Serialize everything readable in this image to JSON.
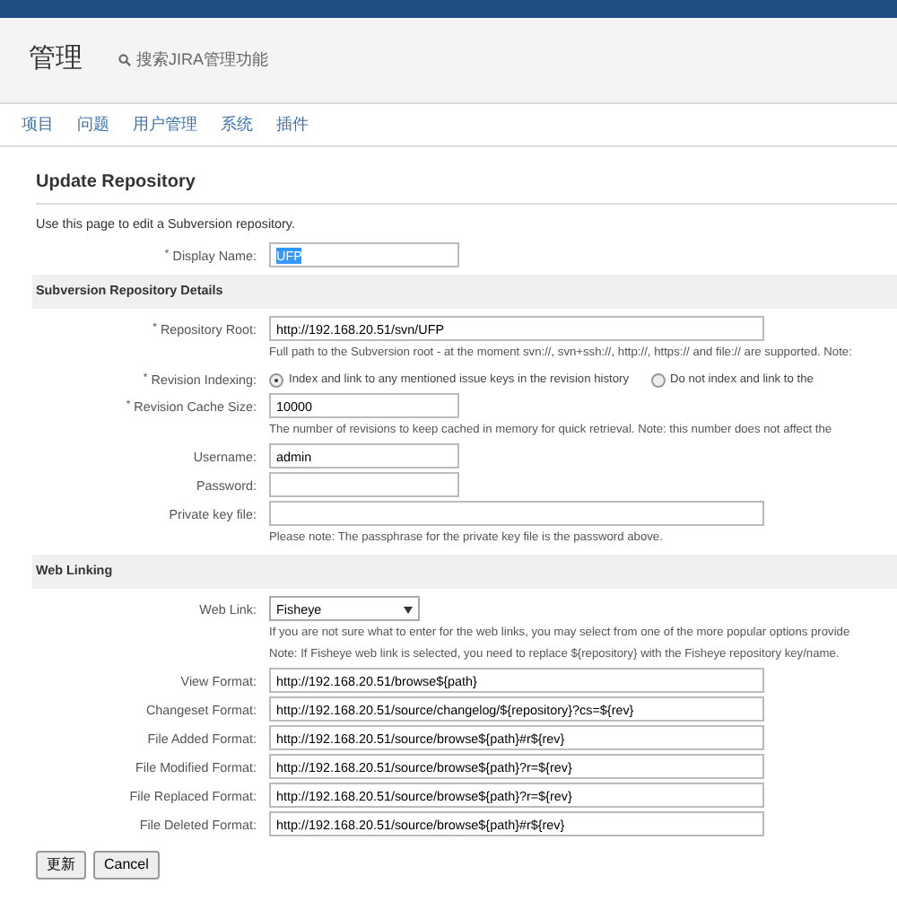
{
  "header": {
    "title": "管理",
    "search_placeholder": "搜索JIRA管理功能"
  },
  "nav": [
    {
      "label": "项目"
    },
    {
      "label": "问题"
    },
    {
      "label": "用户管理"
    },
    {
      "label": "系统"
    },
    {
      "label": "插件"
    }
  ],
  "form": {
    "title": "Update Repository",
    "description": "Use this page to edit a Subversion repository.",
    "sections": [
      {
        "fields": [
          {
            "kind": "short",
            "marker": "*",
            "label": "Display Name:",
            "value": "UFP",
            "text_selected": true
          }
        ]
      },
      {
        "heading": "Subversion Repository Details",
        "fields": [
          {
            "kind": "long",
            "marker": "*",
            "label": "Repository Root:",
            "value": "http://192.168.20.51/svn/UFP",
            "help": [
              "Full path to the Subversion root - at the moment svn://, svn+ssh://, http://, https:// and file:// are supported. Note:"
            ]
          },
          {
            "kind": "radio",
            "marker": "*",
            "label": "Revision Indexing:",
            "options": [
              {
                "label": "Index and link to any mentioned issue keys in the revision history",
                "selected": true
              },
              {
                "label": "Do not index and link to the",
                "selected": false
              }
            ]
          },
          {
            "kind": "short",
            "marker": "*",
            "label": "Revision Cache Size:",
            "value": "10000",
            "help": [
              "The number of revisions to keep cached in memory for quick retrieval. Note: this number does not affect the"
            ]
          },
          {
            "kind": "short",
            "label": "Username:",
            "value": "admin"
          },
          {
            "kind": "short",
            "label": "Password:"
          },
          {
            "kind": "long",
            "label": "Private key file:",
            "help": [
              "Please note: The passphrase for the private key file is the password above."
            ]
          }
        ]
      },
      {
        "heading": "Web Linking",
        "fields": [
          {
            "kind": "select",
            "label": "Web Link:",
            "value": "Fisheye",
            "help": [
              "If you are not sure what to enter for the web links, you may select from one of the more popular options provide",
              "Note: If Fisheye web link is selected, you need to replace ${repository} with the Fisheye repository key/name."
            ]
          },
          {
            "kind": "long",
            "label": "View Format:",
            "value": "http://192.168.20.51/browse${path}"
          },
          {
            "kind": "long",
            "label": "Changeset Format:",
            "value": "http://192.168.20.51/source/changelog/${repository}?cs=${rev}"
          },
          {
            "kind": "long",
            "label": "File Added Format:",
            "value": "http://192.168.20.51/source/browse${path}#r${rev}"
          },
          {
            "kind": "long",
            "label": "File Modified Format:",
            "value": "http://192.168.20.51/source/browse${path}?r=${rev}"
          },
          {
            "kind": "long",
            "label": "File Replaced Format:",
            "value": "http://192.168.20.51/source/browse${path}?r=${rev}"
          },
          {
            "kind": "long",
            "label": "File Deleted Format:",
            "value": "http://192.168.20.51/source/browse${path}#r${rev}"
          }
        ]
      }
    ],
    "buttons": [
      {
        "label": "更新"
      },
      {
        "label": "Cancel"
      }
    ]
  }
}
